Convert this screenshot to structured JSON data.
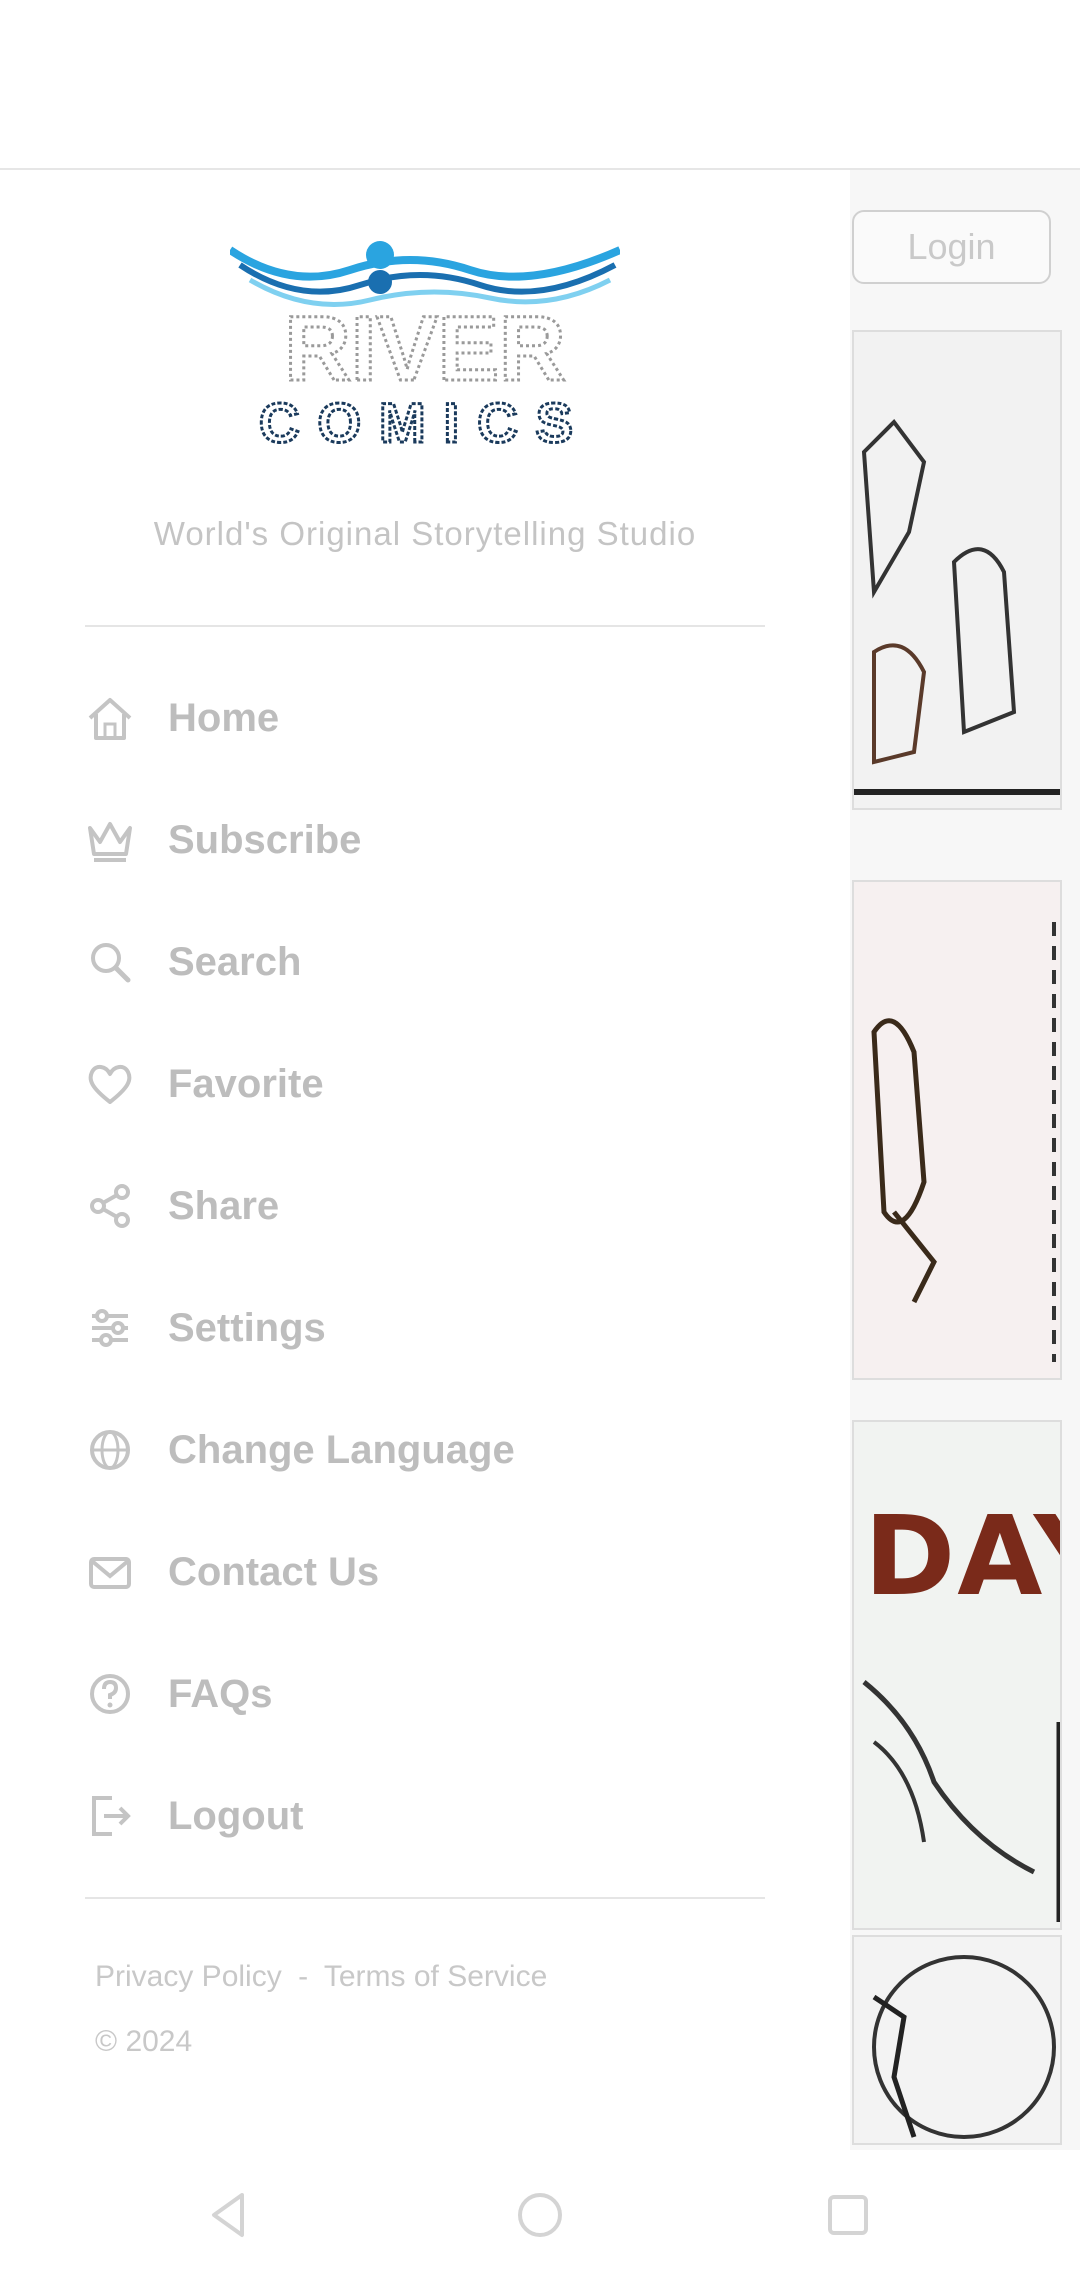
{
  "drawer": {
    "logo": {
      "word_top": "RIVER",
      "word_bottom": "COMICS"
    },
    "tagline": "World's Original Storytelling Studio",
    "menu": [
      {
        "label": "Home",
        "icon": "home-icon"
      },
      {
        "label": "Subscribe",
        "icon": "crown-icon"
      },
      {
        "label": "Search",
        "icon": "search-icon"
      },
      {
        "label": "Favorite",
        "icon": "heart-icon"
      },
      {
        "label": "Share",
        "icon": "share-icon"
      },
      {
        "label": "Settings",
        "icon": "settings-icon"
      },
      {
        "label": "Change Language",
        "icon": "globe-icon"
      },
      {
        "label": "Contact Us",
        "icon": "mail-icon"
      },
      {
        "label": "FAQs",
        "icon": "faq-icon"
      },
      {
        "label": "Logout",
        "icon": "logout-icon"
      }
    ],
    "footer": {
      "privacy": "Privacy Policy",
      "separator": "-",
      "terms": "Terms of Service",
      "copyright": "© 2024"
    }
  },
  "content": {
    "button_label": "Login",
    "thumb_text": "DAY"
  },
  "colors": {
    "logo_wave": "#2aa4e0",
    "logo_text": "#1a3a5c",
    "menu_text": "#bdbdbd",
    "divider": "#e5e5e5"
  }
}
